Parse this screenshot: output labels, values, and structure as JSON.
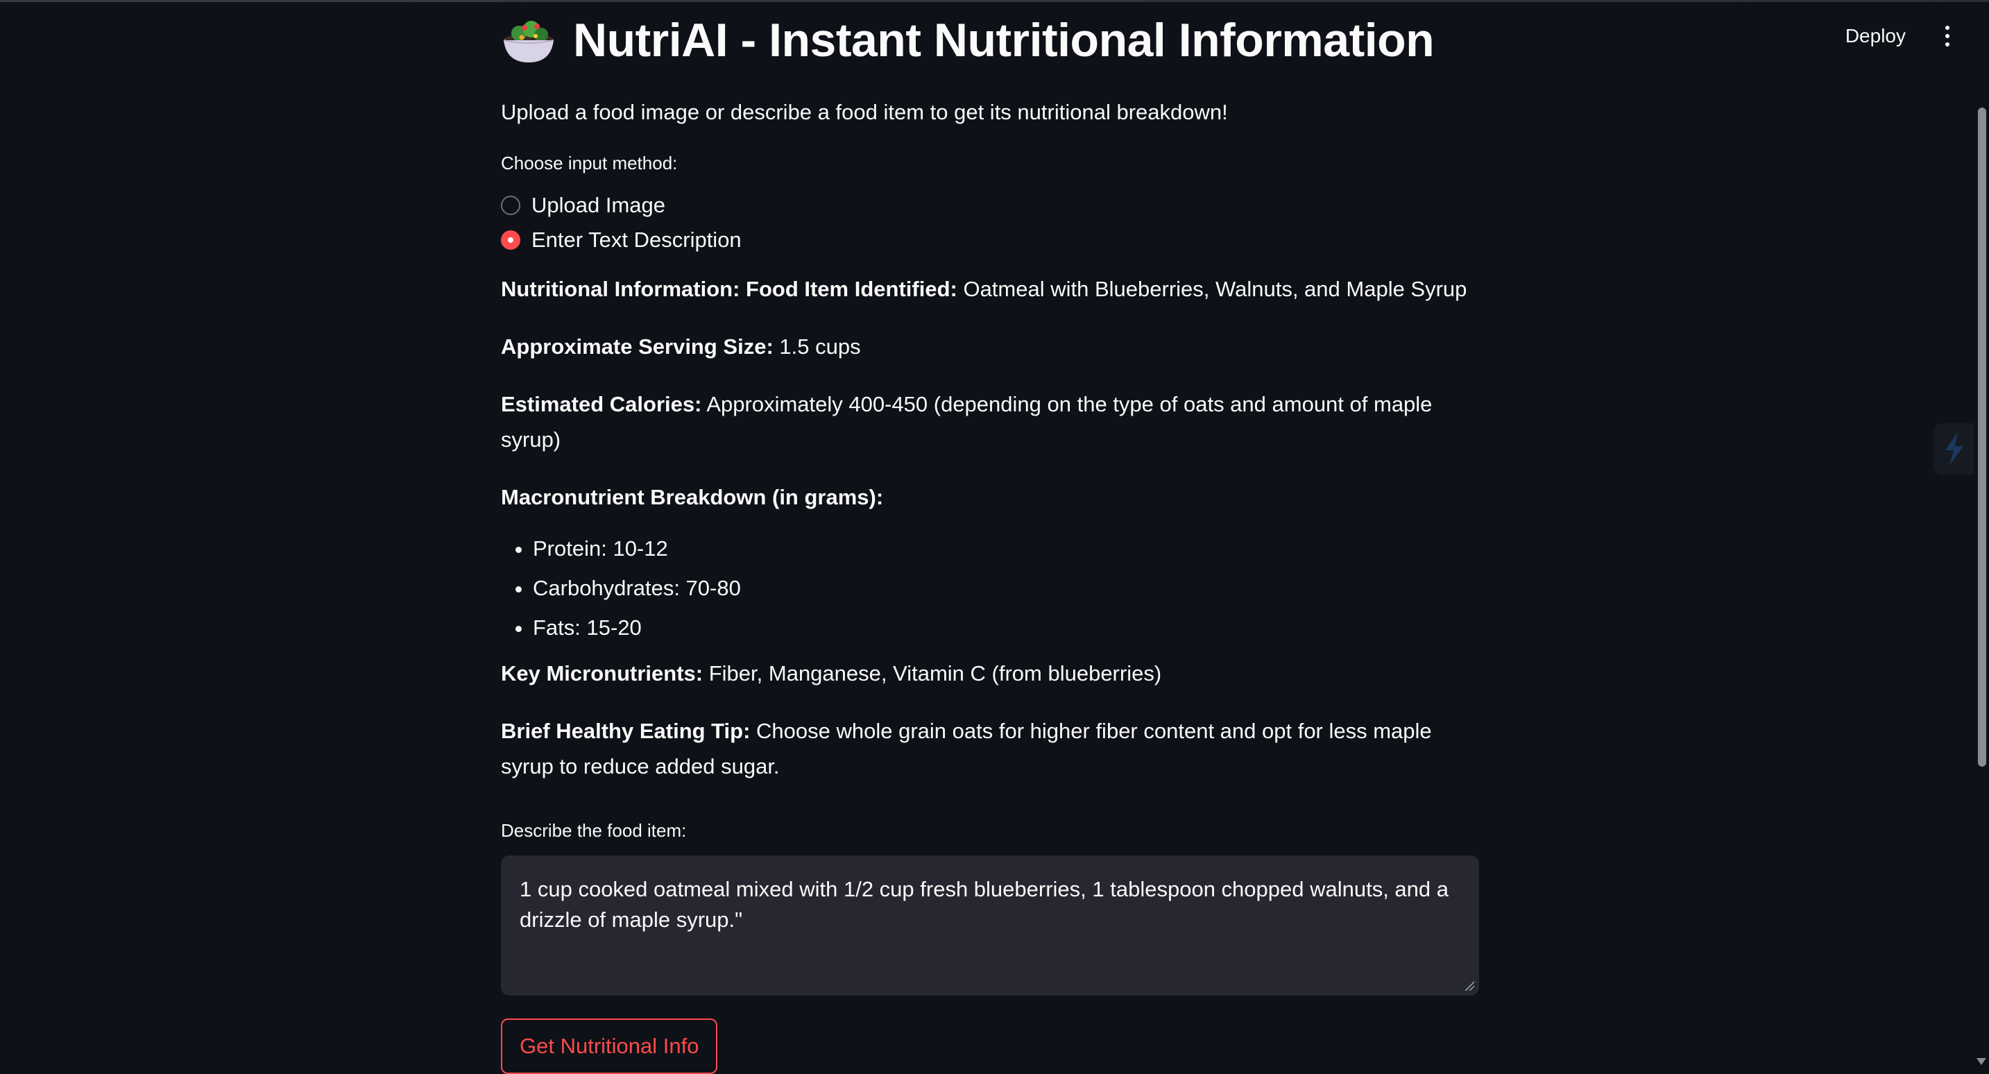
{
  "app": {
    "title": "NutriAI - Instant Nutritional Information",
    "title_emoji": "salad-bowl-icon",
    "intro": "Upload a food image or describe a food item to get its nutritional breakdown!"
  },
  "header": {
    "deploy_label": "Deploy",
    "menu_icon": "kebab-menu-icon"
  },
  "input_method": {
    "label": "Choose input method:",
    "options": [
      {
        "label": "Upload Image",
        "selected": false
      },
      {
        "label": "Enter Text Description",
        "selected": true
      }
    ]
  },
  "result": {
    "food_item": {
      "label": "Nutritional Information: Food Item Identified:",
      "value": "Oatmeal with Blueberries, Walnuts, and Maple Syrup"
    },
    "serving_size": {
      "label": "Approximate Serving Size:",
      "value": "1.5 cups"
    },
    "calories": {
      "label": "Estimated Calories:",
      "value": "Approximately 400-450 (depending on the type of oats and amount of maple syrup)"
    },
    "macro_heading": "Macronutrient Breakdown (in grams):",
    "macros": [
      "Protein: 10-12",
      "Carbohydrates: 70-80",
      "Fats: 15-20"
    ],
    "micronutrients": {
      "label": "Key Micronutrients:",
      "value": "Fiber, Manganese, Vitamin C (from blueberries)"
    },
    "tip": {
      "label": "Brief Healthy Eating Tip:",
      "value": "Choose whole grain oats for higher fiber content and opt for less maple syrup to reduce added sugar."
    }
  },
  "description": {
    "label": "Describe the food item:",
    "value": "1 cup cooked oatmeal mixed with 1/2 cup fresh blueberries, 1 tablespoon chopped walnuts, and a drizzle of maple syrup.\""
  },
  "submit_label": "Get Nutritional Info",
  "colors": {
    "background": "#0e1117",
    "accent": "#ff4b4b",
    "input_bg": "#262730",
    "text": "#fafafa"
  }
}
